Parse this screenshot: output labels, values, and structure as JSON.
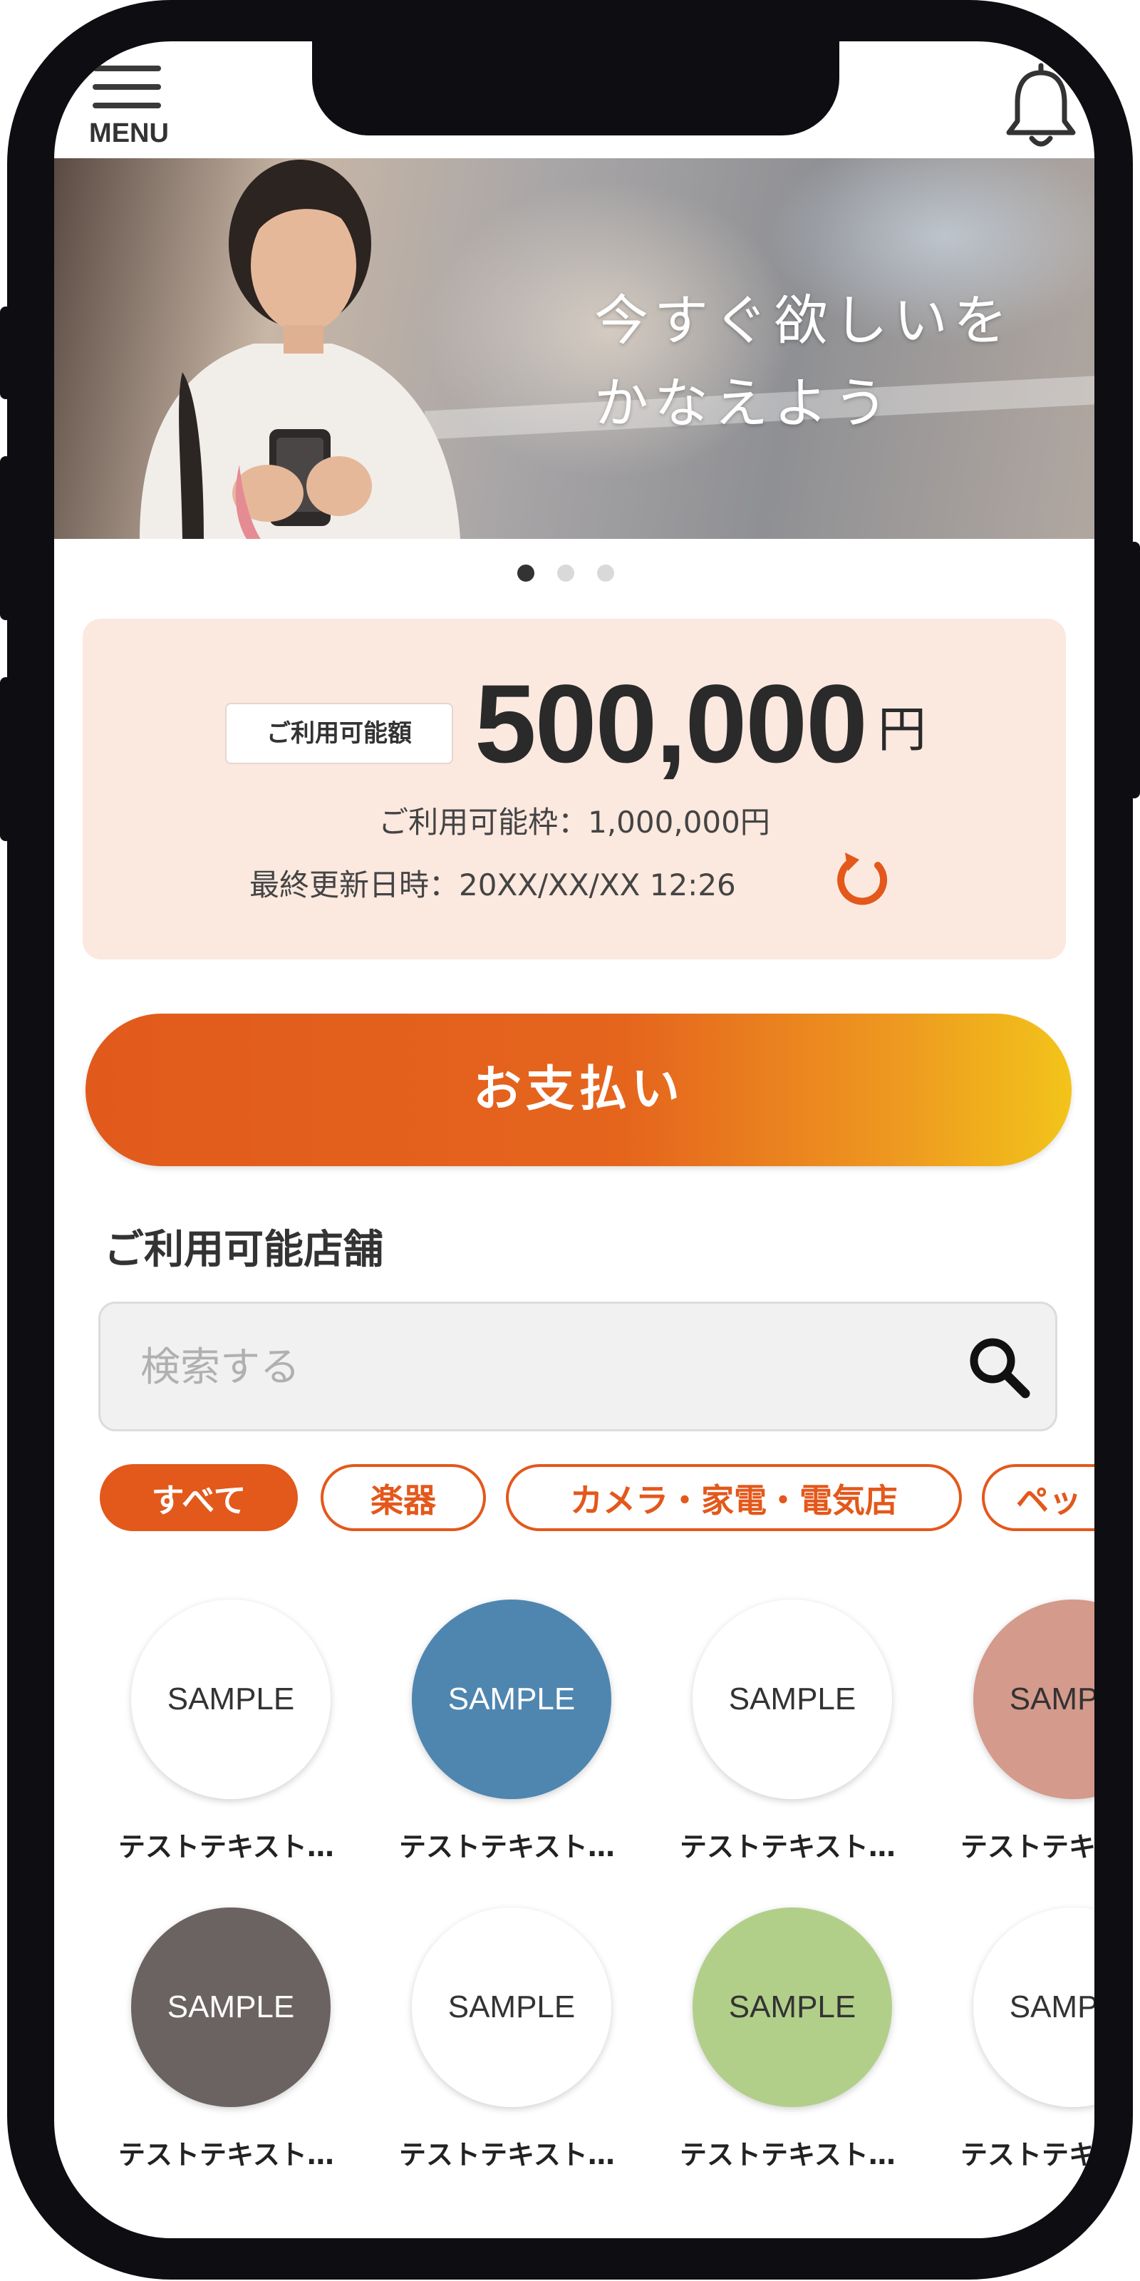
{
  "header": {
    "menu_label": "MENU",
    "menu_icon": "hamburger-icon",
    "notification_icon": "bell-icon"
  },
  "banner": {
    "line1": "今すぐ欲しいを",
    "line2": "かなえよう",
    "slide_count": 3,
    "active_slide": 1
  },
  "balance": {
    "label": "ご利用可能額",
    "amount": "500,000",
    "unit": "円",
    "limit_text": "ご利用可能枠：1,000,000円",
    "updated_text": "最終更新日時：20XX/XX/XX 12:26",
    "refresh_icon": "refresh-icon"
  },
  "pay_button": {
    "label": "お支払い"
  },
  "stores_section": {
    "title": "ご利用可能店舗",
    "search_placeholder": "検索する",
    "search_icon": "search-icon"
  },
  "categories": [
    {
      "label": "すべて",
      "active": true
    },
    {
      "label": "楽器",
      "active": false
    },
    {
      "label": "カメラ・家電・電気店",
      "active": false
    },
    {
      "label": "ペッ",
      "active": false
    }
  ],
  "stores": [
    {
      "logo": "SAMPLE",
      "name": "テストテキスト…",
      "bg": "#ffffff",
      "fg": "#333333"
    },
    {
      "logo": "SAMPLE",
      "name": "テストテキスト…",
      "bg": "#4f86b0",
      "fg": "#ffffff"
    },
    {
      "logo": "SAMPLE",
      "name": "テストテキスト…",
      "bg": "#ffffff",
      "fg": "#333333"
    },
    {
      "logo": "SAMPLE",
      "name": "テストテキスト…",
      "bg": "#d49a8c",
      "fg": "#333333"
    },
    {
      "logo": "SAMPLE",
      "name": "テストテキスト…",
      "bg": "#6b6362",
      "fg": "#ffffff"
    },
    {
      "logo": "SAMPLE",
      "name": "テストテキスト…",
      "bg": "#ffffff",
      "fg": "#333333"
    },
    {
      "logo": "SAMPLE",
      "name": "テストテキスト…",
      "bg": "#b2cf8a",
      "fg": "#333333"
    },
    {
      "logo": "SAMPLE",
      "name": "テストテキスト…",
      "bg": "#ffffff",
      "fg": "#333333"
    }
  ],
  "colors": {
    "accent": "#e3581b",
    "card_bg": "#fbe8df",
    "gradient_end": "#f2c41a"
  }
}
